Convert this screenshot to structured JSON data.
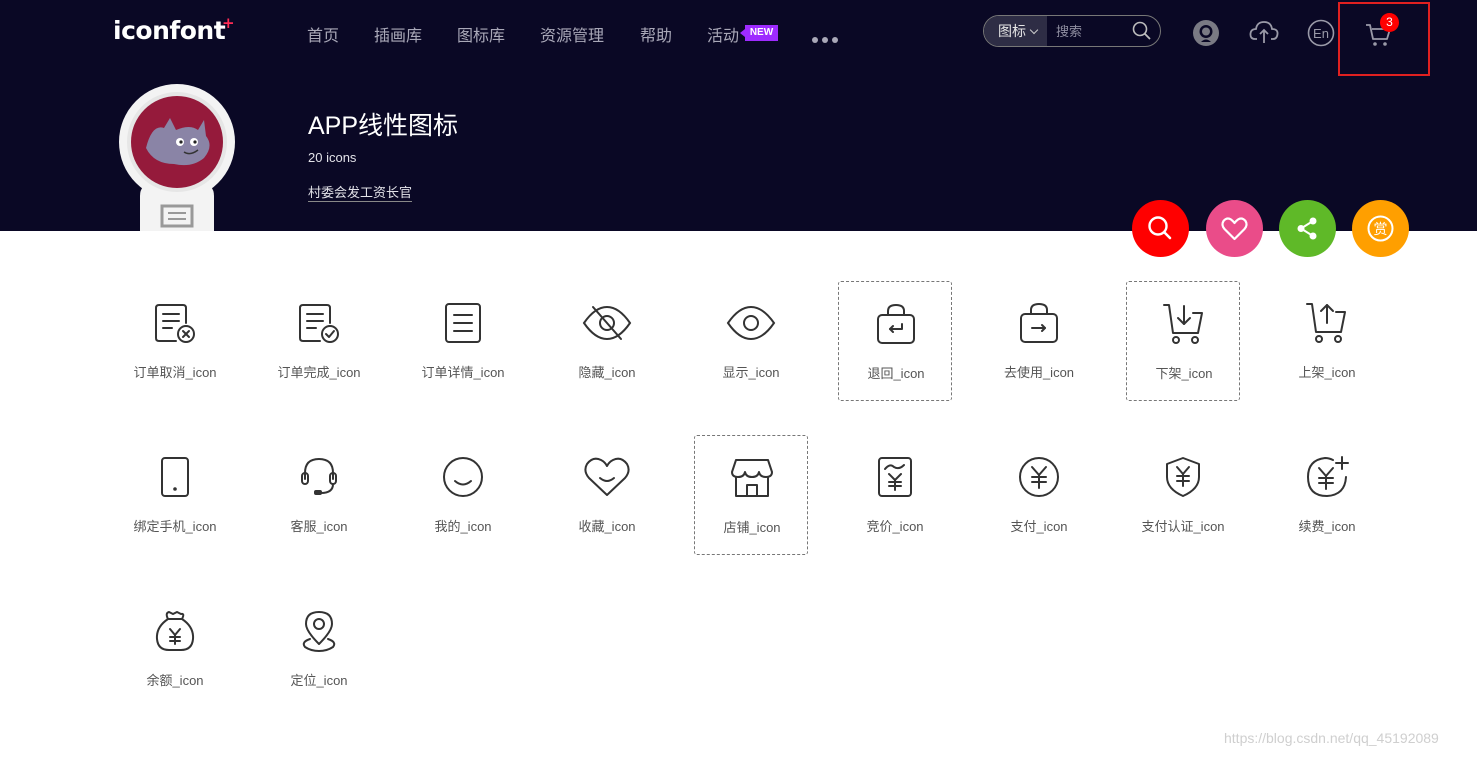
{
  "header": {
    "logo": "iconfont",
    "nav": [
      {
        "label": "首页"
      },
      {
        "label": "插画库"
      },
      {
        "label": "图标库"
      },
      {
        "label": "资源管理"
      },
      {
        "label": "帮助"
      },
      {
        "label": "活动"
      }
    ],
    "new_badge": "NEW",
    "search": {
      "type": "图标",
      "placeholder": "搜索"
    },
    "lang": "En",
    "cart_count": "3"
  },
  "project": {
    "title": "APP线性图标",
    "count": "20 icons",
    "author": "村委会发工资长官"
  },
  "actions": {
    "reward_glyph": "赏"
  },
  "icons": [
    {
      "label": "订单取消_icon",
      "name": "order-cancel-icon"
    },
    {
      "label": "订单完成_icon",
      "name": "order-complete-icon"
    },
    {
      "label": "订单详情_icon",
      "name": "order-detail-icon"
    },
    {
      "label": "隐藏_icon",
      "name": "eye-hidden-icon"
    },
    {
      "label": "显示_icon",
      "name": "eye-icon"
    },
    {
      "label": "退回_icon",
      "name": "bag-return-icon"
    },
    {
      "label": "去使用_icon",
      "name": "bag-use-icon"
    },
    {
      "label": "下架_icon",
      "name": "cart-down-icon"
    },
    {
      "label": "上架_icon",
      "name": "cart-up-icon"
    },
    {
      "label": "绑定手机_icon",
      "name": "phone-icon"
    },
    {
      "label": "客服_icon",
      "name": "headset-icon"
    },
    {
      "label": "我的_icon",
      "name": "smile-icon"
    },
    {
      "label": "收藏_icon",
      "name": "heart-icon"
    },
    {
      "label": "店铺_icon",
      "name": "shop-icon"
    },
    {
      "label": "竞价_icon",
      "name": "bid-icon"
    },
    {
      "label": "支付_icon",
      "name": "yuan-circle-icon"
    },
    {
      "label": "支付认证_icon",
      "name": "yuan-shield-icon"
    },
    {
      "label": "续费_icon",
      "name": "yuan-renew-icon"
    },
    {
      "label": "余额_icon",
      "name": "money-bag-icon"
    },
    {
      "label": "定位_icon",
      "name": "location-icon"
    }
  ],
  "watermark": "https://blog.csdn.net/qq_45192089",
  "colors": {
    "header_bg": "#0a0825",
    "search_fab": "#ff0000",
    "like_fab": "#ea4c89",
    "share_fab": "#5fb928",
    "reward_fab": "#ff9f00"
  }
}
